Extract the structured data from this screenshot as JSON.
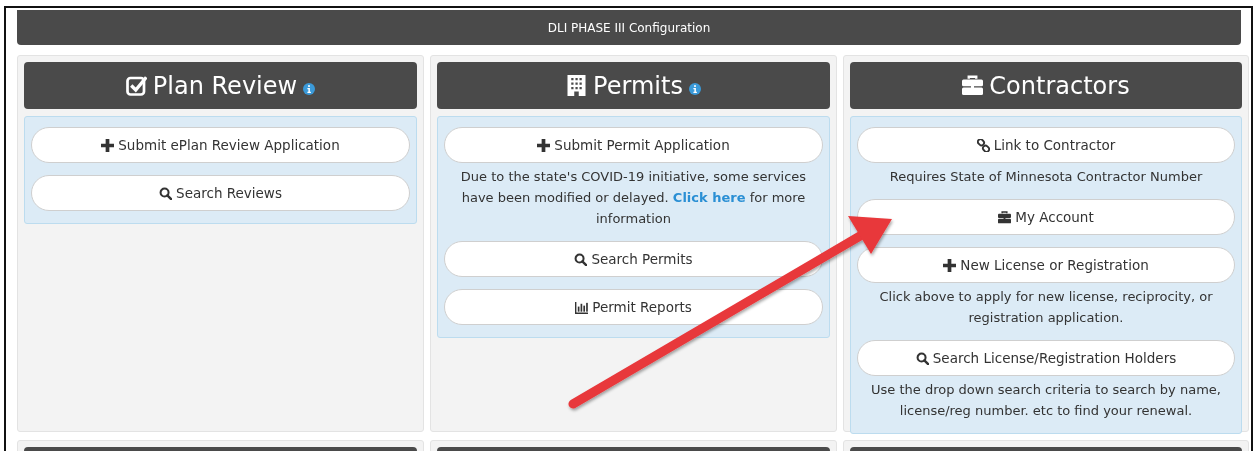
{
  "header": {
    "title": "DLI PHASE III Configuration"
  },
  "columns": [
    {
      "title": "Plan Review",
      "info": true,
      "items": [
        {
          "kind": "add",
          "label": "Submit ePlan Review Application"
        },
        {
          "kind": "search",
          "label": "Search Reviews"
        }
      ]
    },
    {
      "title": "Permits",
      "info": true,
      "items": [
        {
          "kind": "add",
          "label": "Submit Permit Application"
        },
        {
          "kind": "note",
          "text": "Due to the state's COVID-19 initiative, some services have been modified or delayed.",
          "link": "Click here",
          "after": "for more information"
        },
        {
          "kind": "search",
          "label": "Search Permits"
        },
        {
          "kind": "report",
          "label": "Permit Reports"
        }
      ]
    },
    {
      "title": "Contractors",
      "info": false,
      "items": [
        {
          "kind": "link",
          "label": "Link to Contractor"
        },
        {
          "kind": "note",
          "text": "Requires State of Minnesota Contractor Number"
        },
        {
          "kind": "account",
          "label": "My Account"
        },
        {
          "kind": "add",
          "label": "New License or Registration"
        },
        {
          "kind": "note",
          "text": "Click above to apply for new license, reciprocity, or registration application."
        },
        {
          "kind": "search",
          "label": "Search License/Registration Holders"
        },
        {
          "kind": "note",
          "text": "Use the drop down search criteria to search by name, license/reg number. etc to find your renewal."
        }
      ]
    }
  ]
}
